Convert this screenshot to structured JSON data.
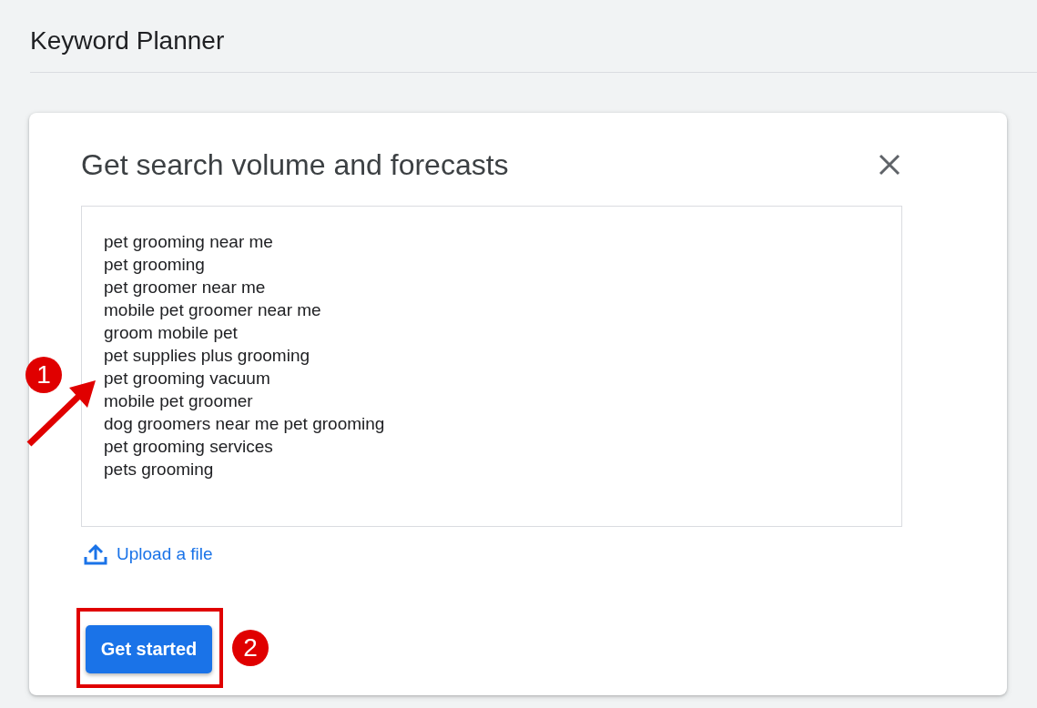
{
  "page": {
    "title": "Keyword Planner"
  },
  "dialog": {
    "title": "Get search volume and forecasts",
    "keywords": [
      "pet grooming near me",
      "pet grooming",
      "pet groomer near me",
      "mobile pet groomer near me",
      "groom mobile pet",
      "pet supplies plus grooming",
      "pet grooming vacuum",
      "mobile pet groomer",
      "dog groomers near me pet grooming",
      "pet grooming services",
      "pets grooming"
    ],
    "upload_link": "Upload a file",
    "primary_button": "Get started"
  },
  "annotations": [
    {
      "label": "1"
    },
    {
      "label": "2"
    }
  ]
}
